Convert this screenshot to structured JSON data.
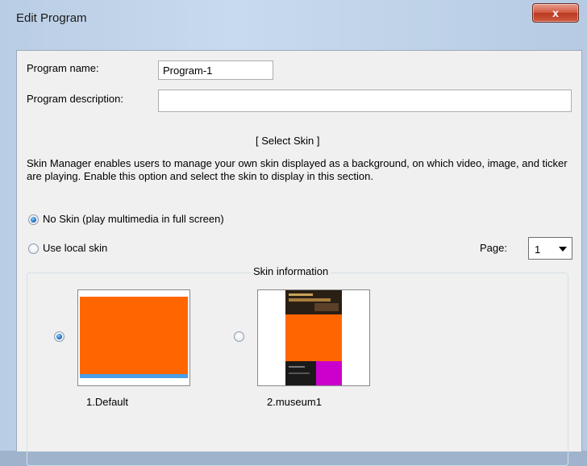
{
  "window": {
    "title": "Edit Program",
    "close_glyph": "x"
  },
  "form": {
    "program_name_label": "Program name:",
    "program_name_value": "Program-1",
    "program_description_label": "Program description:",
    "program_description_value": ""
  },
  "skin": {
    "section_title": "[ Select Skin ]",
    "description": "Skin Manager enables users to manage your own skin displayed as a background, on which video, image, and ticker are playing. Enable this option and select the skin to display in this section.",
    "options": [
      {
        "label": "No Skin (play multimedia in full screen)",
        "selected": true
      },
      {
        "label": "Use local skin",
        "selected": false
      }
    ],
    "page_label": "Page:",
    "page_value": "1",
    "info_title": "Skin information",
    "items": [
      {
        "name": "1.Default",
        "selected": true
      },
      {
        "name": "2.museum1",
        "selected": false
      }
    ]
  },
  "colors": {
    "skin_orange": "#ff6600",
    "skin_blue": "#4a9ee8",
    "skin_purple": "#cc00cc",
    "radio_dot": "#1f6fc0"
  }
}
